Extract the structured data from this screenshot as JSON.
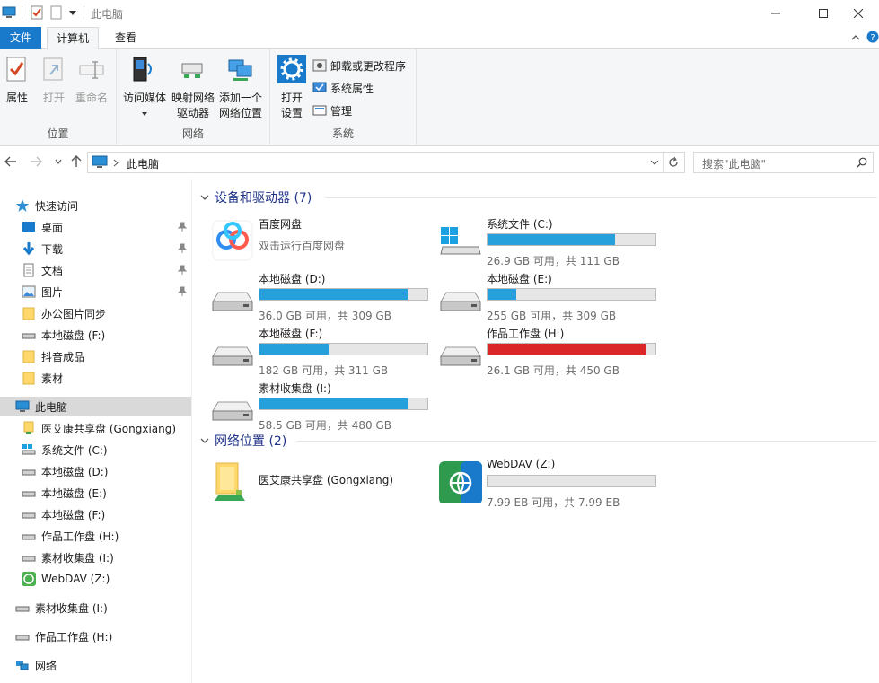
{
  "window": {
    "title": "此电脑",
    "controls": [
      "minimize-icon",
      "maximize-icon",
      "close-icon"
    ]
  },
  "ribbon": {
    "tabs": [
      "文件",
      "计算机",
      "查看"
    ],
    "groups": {
      "location": {
        "label": "位置",
        "buttons": {
          "properties": "属性",
          "open": "打开",
          "rename": "重命名"
        }
      },
      "network": {
        "label": "网络",
        "buttons": {
          "media": "访问媒体",
          "map_drive_1": "映射网络",
          "map_drive_2": "驱动器",
          "add_loc_1": "添加一个",
          "add_loc_2": "网络位置"
        }
      },
      "system": {
        "label": "系统",
        "open_settings_1": "打开",
        "open_settings_2": "设置",
        "uninstall": "卸载或更改程序",
        "sys_props": "系统属性",
        "manage": "管理"
      }
    }
  },
  "address": {
    "path": "此电脑",
    "search_placeholder": "搜索\"此电脑\""
  },
  "nav": {
    "quick_access": "快速访问",
    "quick_items": [
      {
        "label": "桌面",
        "pinned": true
      },
      {
        "label": "下载",
        "pinned": true
      },
      {
        "label": "文档",
        "pinned": true
      },
      {
        "label": "图片",
        "pinned": true
      },
      {
        "label": "办公图片同步",
        "pinned": false
      },
      {
        "label": "本地磁盘 (F:)",
        "pinned": false
      },
      {
        "label": "抖音成品",
        "pinned": false
      },
      {
        "label": "素材",
        "pinned": false
      }
    ],
    "this_pc": "此电脑",
    "pc_items": [
      "医艾康共享盘 (Gongxiang)",
      "系统文件 (C:)",
      "本地磁盘 (D:)",
      "本地磁盘 (E:)",
      "本地磁盘 (F:)",
      "作品工作盘 (H:)",
      "素材收集盘 (I:)",
      "WebDAV (Z:)"
    ],
    "root_items": [
      "素材收集盘 (I:)",
      "作品工作盘 (H:)",
      "网络"
    ]
  },
  "content": {
    "devices_header": "设备和驱动器 (7)",
    "network_header": "网络位置 (2)",
    "baidu": {
      "name": "百度网盘",
      "sub": "双击运行百度网盘"
    },
    "drives": [
      {
        "name": "系统文件 (C:)",
        "info": "26.9 GB 可用，共 111 GB",
        "used_fraction": 0.76,
        "color": "#26a0da"
      },
      {
        "name": "本地磁盘 (D:)",
        "info": "36.0 GB 可用，共 309 GB",
        "used_fraction": 0.88,
        "color": "#26a0da"
      },
      {
        "name": "本地磁盘 (E:)",
        "info": "255 GB 可用，共 309 GB",
        "used_fraction": 0.17,
        "color": "#26a0da"
      },
      {
        "name": "本地磁盘 (F:)",
        "info": "182 GB 可用，共 311 GB",
        "used_fraction": 0.41,
        "color": "#26a0da"
      },
      {
        "name": "作品工作盘 (H:)",
        "info": "26.1 GB 可用，共 450 GB",
        "used_fraction": 0.94,
        "color": "#da2626"
      },
      {
        "name": "素材收集盘 (I:)",
        "info": "58.5 GB 可用，共 480 GB",
        "used_fraction": 0.88,
        "color": "#26a0da"
      }
    ],
    "network": [
      {
        "name": "医艾康共享盘 (Gongxiang)"
      },
      {
        "name": "WebDAV (Z:)",
        "info": "7.99 EB 可用，共 7.99 EB",
        "used_fraction": 0.0
      }
    ]
  }
}
